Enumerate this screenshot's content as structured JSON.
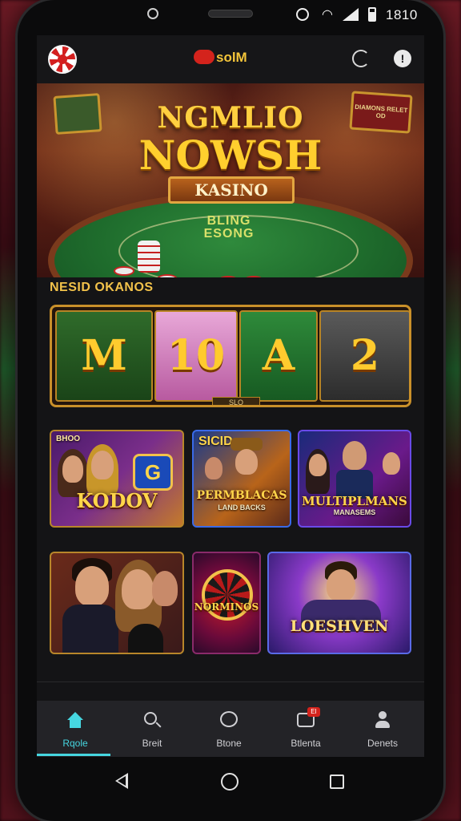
{
  "status_bar": {
    "time": "1810"
  },
  "header": {
    "brand": "solM"
  },
  "hero": {
    "title_line1": "NGMLIO",
    "title_line2": "NOWSH",
    "ribbon": "KASINO",
    "felt_line1": "BLING",
    "felt_line2": "ESONG",
    "sign_left": "",
    "sign_right": "DIAMONS RELET OD"
  },
  "section": {
    "title": "NESID OKANOS"
  },
  "slot_strip": {
    "reels": [
      "M",
      "10",
      "A",
      "2"
    ],
    "label": "SLO"
  },
  "tiles": [
    {
      "tag": "BHOO",
      "title": "KODOV",
      "sub": ""
    },
    {
      "tag": "SICID",
      "title": "PERMBLACAS",
      "sub": "LAND BACKS"
    },
    {
      "tag": "",
      "title": "MULTIPLMANS",
      "sub": "MANASEMS"
    },
    {
      "tag": "",
      "title": "",
      "sub": ""
    },
    {
      "tag": "",
      "title": "NORMINOS",
      "sub": ""
    },
    {
      "tag": "",
      "title": "LOESHVEN",
      "sub": ""
    }
  ],
  "bottom_nav": [
    {
      "label": "Rqole",
      "icon": "home-icon",
      "active": true
    },
    {
      "label": "Breit",
      "icon": "search-icon",
      "active": false
    },
    {
      "label": "Btone",
      "icon": "chat-icon",
      "active": false
    },
    {
      "label": "Btlenta",
      "icon": "promo-icon",
      "active": false,
      "badge": "EI"
    },
    {
      "label": "Denets",
      "icon": "user-icon",
      "active": false
    }
  ],
  "colors": {
    "accent": "#46d6e0",
    "gold": "#f2c24a",
    "brand_red": "#d4231c"
  }
}
